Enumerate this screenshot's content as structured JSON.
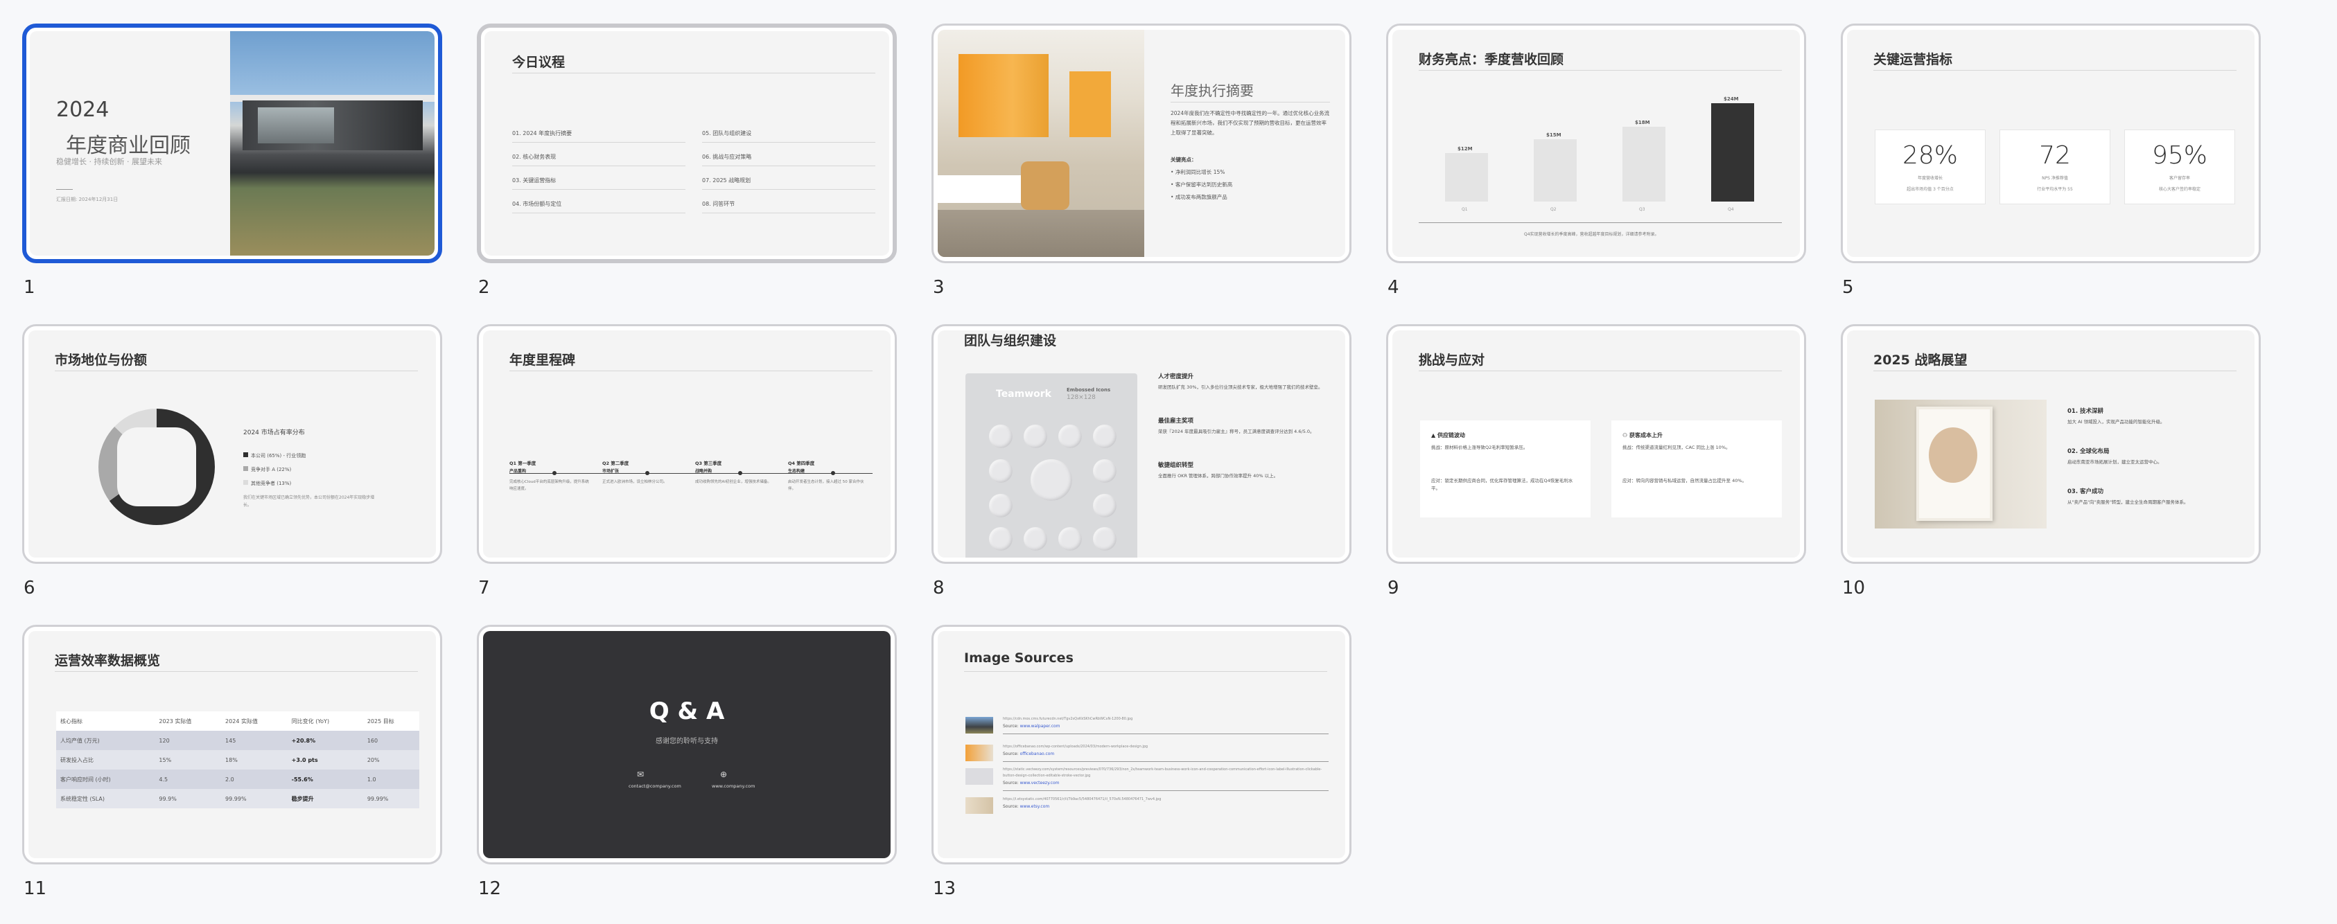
{
  "slides": [
    {
      "num": "1",
      "title_year": "2024",
      "title_main": "年度商业回顾",
      "subtitle": "稳健增长 · 持续创新 · 展望未来",
      "footer": "汇报日期: 2024年12月31日"
    },
    {
      "num": "2",
      "title": "今日议程",
      "agenda_left": [
        "01. 2024 年度执行摘要",
        "02. 核心财务表现",
        "03. 关键运营指标",
        "04. 市场份额与定位"
      ],
      "agenda_right": [
        "05. 团队与组织建设",
        "06. 挑战与应对策略",
        "07. 2025 战略规划",
        "08. 问答环节"
      ]
    },
    {
      "num": "3",
      "title": "年度执行摘要",
      "body": "2024年度我们在不确定性中寻找确定性的一年。通过优化核心业务流程和拓展新兴市场，我们不仅实现了预期的营收目标，更在运营效率上取得了显著突破。",
      "key_label": "关键亮点：",
      "bullets": [
        "净利润同比增长 15%",
        "客户保留率达到历史新高",
        "成功发布两款旗舰产品"
      ]
    },
    {
      "num": "4",
      "title": "财务亮点：季度营收回顾",
      "bars": [
        {
          "label": "$12M",
          "cat": "Q1"
        },
        {
          "label": "$15M",
          "cat": "Q2"
        },
        {
          "label": "$18M",
          "cat": "Q3"
        },
        {
          "label": "$24M",
          "cat": "Q4"
        }
      ],
      "note": "Q4实现营收增长的季度高峰，营收超越年度目标规划，详细请参考附录。"
    },
    {
      "num": "5",
      "title": "关键运营指标",
      "metrics": [
        {
          "value": "28%",
          "label": "年度营收增长",
          "sub": "超出市场均值 3 个百分点"
        },
        {
          "value": "72",
          "label": "NPS 净推荐值",
          "sub": "行业平均水平为 55"
        },
        {
          "value": "95%",
          "label": "客户留存率",
          "sub": "核心大客户签约率稳定"
        }
      ]
    },
    {
      "num": "6",
      "title": "市场地位与份额",
      "chart_title": "2024 市场占有率分布",
      "legend": [
        "本公司 (65%) - 行业领跑",
        "竞争对手 A (22%)",
        "其他竞争者 (13%)"
      ],
      "note": "我们在关键市场区域已确立领先优势，本公司份额在2024年实现稳步增长。"
    },
    {
      "num": "7",
      "title": "年度里程碑",
      "milestones": [
        {
          "q": "Q1 第一季度",
          "h": "产品重构",
          "d": "完成核心Cloud平台的底层架构升级，提升系统响应速度。"
        },
        {
          "q": "Q2 第二季度",
          "h": "市场扩张",
          "d": "正式进入欧洲市场，设立柏林分公司。"
        },
        {
          "q": "Q3 第三季度",
          "h": "战略并购",
          "d": "成功收购领先的AI初创企业，增强技术储备。"
        },
        {
          "q": "Q4 第四季度",
          "h": "生态构建",
          "d": "启动开发者生态计划，接入超过 50 家合作伙伴。"
        }
      ]
    },
    {
      "num": "8",
      "title": "团队与组织建设",
      "panel_title": "Teamwork",
      "panel_badge": "Embossed Icons",
      "panel_badge2": "128×128",
      "sections": [
        {
          "h": "人才密度提升",
          "d": "研发团队扩充 30%，引入多位行业顶尖技术专家，极大地增强了我们的技术壁垒。"
        },
        {
          "h": "最佳雇主奖项",
          "d": "荣获『2024 年度最具吸引力雇主』称号，员工满意度调查评分达到 4.6/5.0。"
        },
        {
          "h": "敏捷组织转型",
          "d": "全面推行 OKR 管理体系，跨部门协作效率提升 40% 以上。"
        }
      ]
    },
    {
      "num": "9",
      "title": "挑战与应对",
      "boxes": [
        {
          "h": "供应链波动",
          "c": "挑战：原材料价格上涨导致Q2毛利率短暂承压。",
          "r": "应对：锁定长期供应商合同，优化库存管理算法，成功在Q4恢复毛利水平。"
        },
        {
          "h": "获客成本上升",
          "c": "挑战：传统渠道流量红利见顶，CAC 同比上涨 10%。",
          "r": "应对：转向内容营销与私域运营，自然流量占比提升至 40%。"
        }
      ]
    },
    {
      "num": "10",
      "title": "2025 战略展望",
      "items": [
        {
          "h": "01. 技术深耕",
          "d": "加大 AI 领域投入，实现产品功能的智能化升级。"
        },
        {
          "h": "02. 全球化布局",
          "d": "启动东南亚市场拓展计划，建立亚太运营中心。"
        },
        {
          "h": "03. 客户成功",
          "d": "从\"卖产品\"向\"卖服务\"转型，建立全生命周期客户服务体系。"
        }
      ]
    },
    {
      "num": "11",
      "title": "运营效率数据概览",
      "table": {
        "headers": [
          "核心指标",
          "2023 实际值",
          "2024 实际值",
          "同比变化 (YoY)",
          "2025 目标"
        ],
        "rows": [
          [
            "人均产值 (万元)",
            "120",
            "145",
            "+20.8%",
            "160"
          ],
          [
            "研发投入占比",
            "15%",
            "18%",
            "+3.0 pts",
            "20%"
          ],
          [
            "客户响应时间 (小时)",
            "4.5",
            "2.0",
            "-55.6%",
            "1.0"
          ],
          [
            "系统稳定性 (SLA)",
            "99.9%",
            "99.99%",
            "稳步提升",
            "99.99%"
          ]
        ]
      }
    },
    {
      "num": "12",
      "title": "Q & A",
      "subtitle": "感谢您的聆听与支持",
      "email": "contact@company.com",
      "web": "www.company.com"
    },
    {
      "num": "13",
      "title": "Image Sources",
      "sources": [
        {
          "url": "https://cdn.mos.cms.futurecdn.net/Tgv2sQxKkSKhCwRbWCxN-1200-80.jpg",
          "label": "Source:",
          "site": "www.walpaper.com"
        },
        {
          "url": "https://officebanao.com/wp-content/uploads/2024/03/modern-workplace-design.jpg",
          "label": "Source:",
          "site": "officebanao.com"
        },
        {
          "url": "https://static.vecteezy.com/system/resources/previews/070/736/293/non_2x/teamwork-team-business-work-icon-and-cooperation-communication-effort-icon-label-illustration-clickable-button-design-collection-editable-stroke-vector.jpg",
          "label": "Source:",
          "site": "www.vecteezy.com"
        },
        {
          "url": "https://i.etsystatic.com/40770561/r/il/7b9ac5/5480476471/il_570xN.5480476471_7wv4.jpg",
          "label": "Source:",
          "site": "www.etsy.com"
        }
      ]
    }
  ]
}
